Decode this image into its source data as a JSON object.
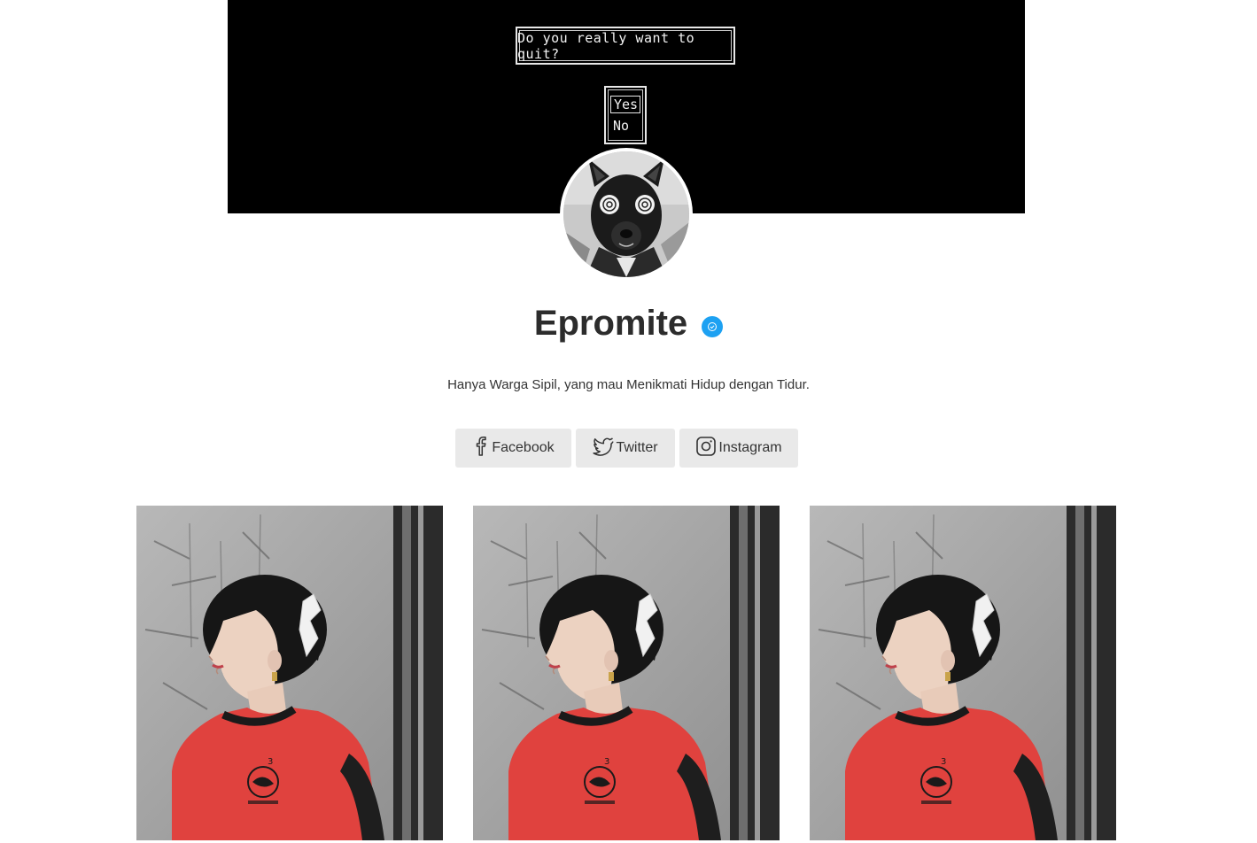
{
  "cover": {
    "dialog_text": "Do you really want to quit?",
    "choices": [
      "Yes",
      "No"
    ],
    "selected_choice": "Yes"
  },
  "profile": {
    "name": "Epromite",
    "verified": true,
    "bio": "Hanya Warga Sipil, yang mau Menikmati Hidup dengan Tidur."
  },
  "socials": [
    {
      "label": "Facebook",
      "icon": "facebook-icon"
    },
    {
      "label": "Twitter",
      "icon": "twitter-icon"
    },
    {
      "label": "Instagram",
      "icon": "instagram-icon"
    }
  ],
  "gallery": [
    {
      "kind": "photo"
    },
    {
      "kind": "photo"
    },
    {
      "kind": "photo"
    }
  ],
  "colors": {
    "verified_badge": "#1da1f2",
    "button_bg": "#e9e9e9",
    "shirt_red": "#e0423e"
  }
}
